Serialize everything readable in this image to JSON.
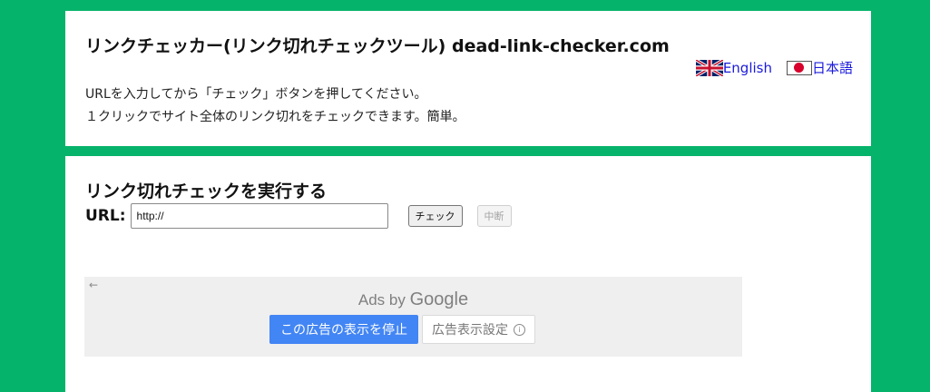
{
  "header": {
    "title": "リンクチェッカー(リンク切れチェックツール) dead-link-checker.com",
    "languages": [
      {
        "label": "English",
        "icon": "uk-flag-icon"
      },
      {
        "label": "日本語",
        "icon": "japan-flag-icon"
      }
    ],
    "intro_lines": [
      "URLを入力してから「チェック」ボタンを押してください。",
      "１クリックでサイト全体のリンク切れをチェックできます。簡単。"
    ]
  },
  "checker": {
    "title": "リンク切れチェックを実行する",
    "url_label": "URL:",
    "url_value": "http://",
    "check_button": "チェック",
    "stop_button": "中断"
  },
  "ad": {
    "ads_by": "Ads by",
    "brand": "Google",
    "stop_ad_button": "この広告の表示を停止",
    "settings_button": "広告表示設定",
    "back_icon": "back-arrow-icon",
    "info_icon": "info-icon"
  },
  "colors": {
    "background": "#06b36a",
    "link": "#1a1adb",
    "ad_button": "#4285f4"
  }
}
